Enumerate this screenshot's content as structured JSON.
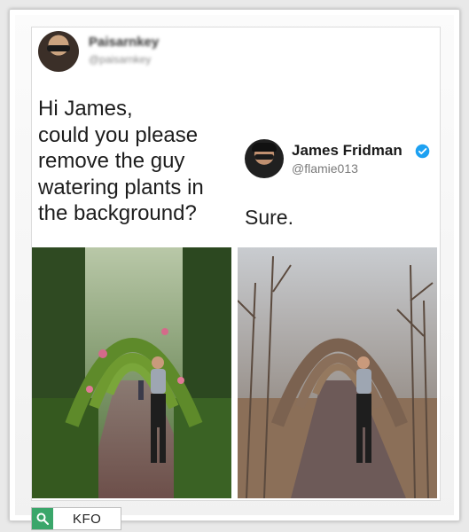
{
  "post": {
    "author_name": "Paisarnkey",
    "author_handle": "@paisarnkey",
    "question_lines": [
      "Hi James,",
      "could you please",
      "remove the guy",
      "watering plants in",
      "the background?"
    ]
  },
  "reply": {
    "author_name": "James Fridman",
    "author_handle": "@flamie013",
    "text": "Sure."
  },
  "footer": {
    "label": "KFO",
    "icon": "search-icon",
    "accent": "#3aa66a"
  }
}
